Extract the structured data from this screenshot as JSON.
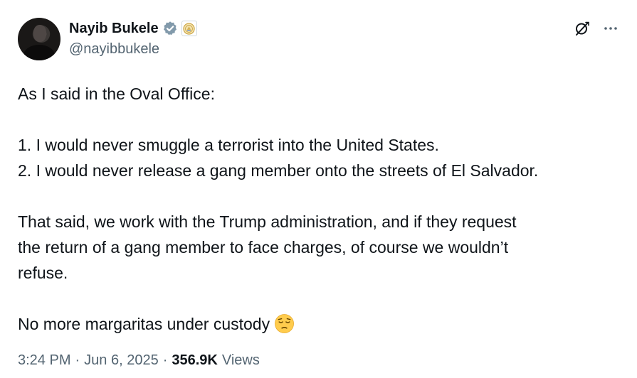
{
  "author": {
    "display_name": "Nayib Bukele",
    "handle": "@nayibbukele"
  },
  "tweet": {
    "paragraphs": [
      [
        "As I said in the Oval Office:"
      ],
      [
        "1. I would never smuggle a terrorist into the United States.",
        "2. I would never release a gang member onto the streets of El Salvador."
      ],
      [
        "That said, we work with the Trump administration, and if they request",
        "the return of a gang member to face charges, of course we wouldn’t",
        "refuse."
      ],
      [
        "No more margaritas under custody"
      ]
    ]
  },
  "meta": {
    "time": "3:24 PM",
    "separator": "·",
    "date": "Jun 6, 2025",
    "views_count": "356.9K",
    "views_label": "Views"
  },
  "icons": {
    "verified": "verified-badge-icon",
    "affiliate": "government-seal-icon",
    "grok": "grok-icon",
    "more": "more-icon",
    "emoji": "pensive-face-emoji"
  },
  "colors": {
    "text_primary": "#0f1419",
    "text_secondary": "#536471",
    "verified_blue": "#1d9bf0",
    "seal_gold": "#c9a13b"
  }
}
